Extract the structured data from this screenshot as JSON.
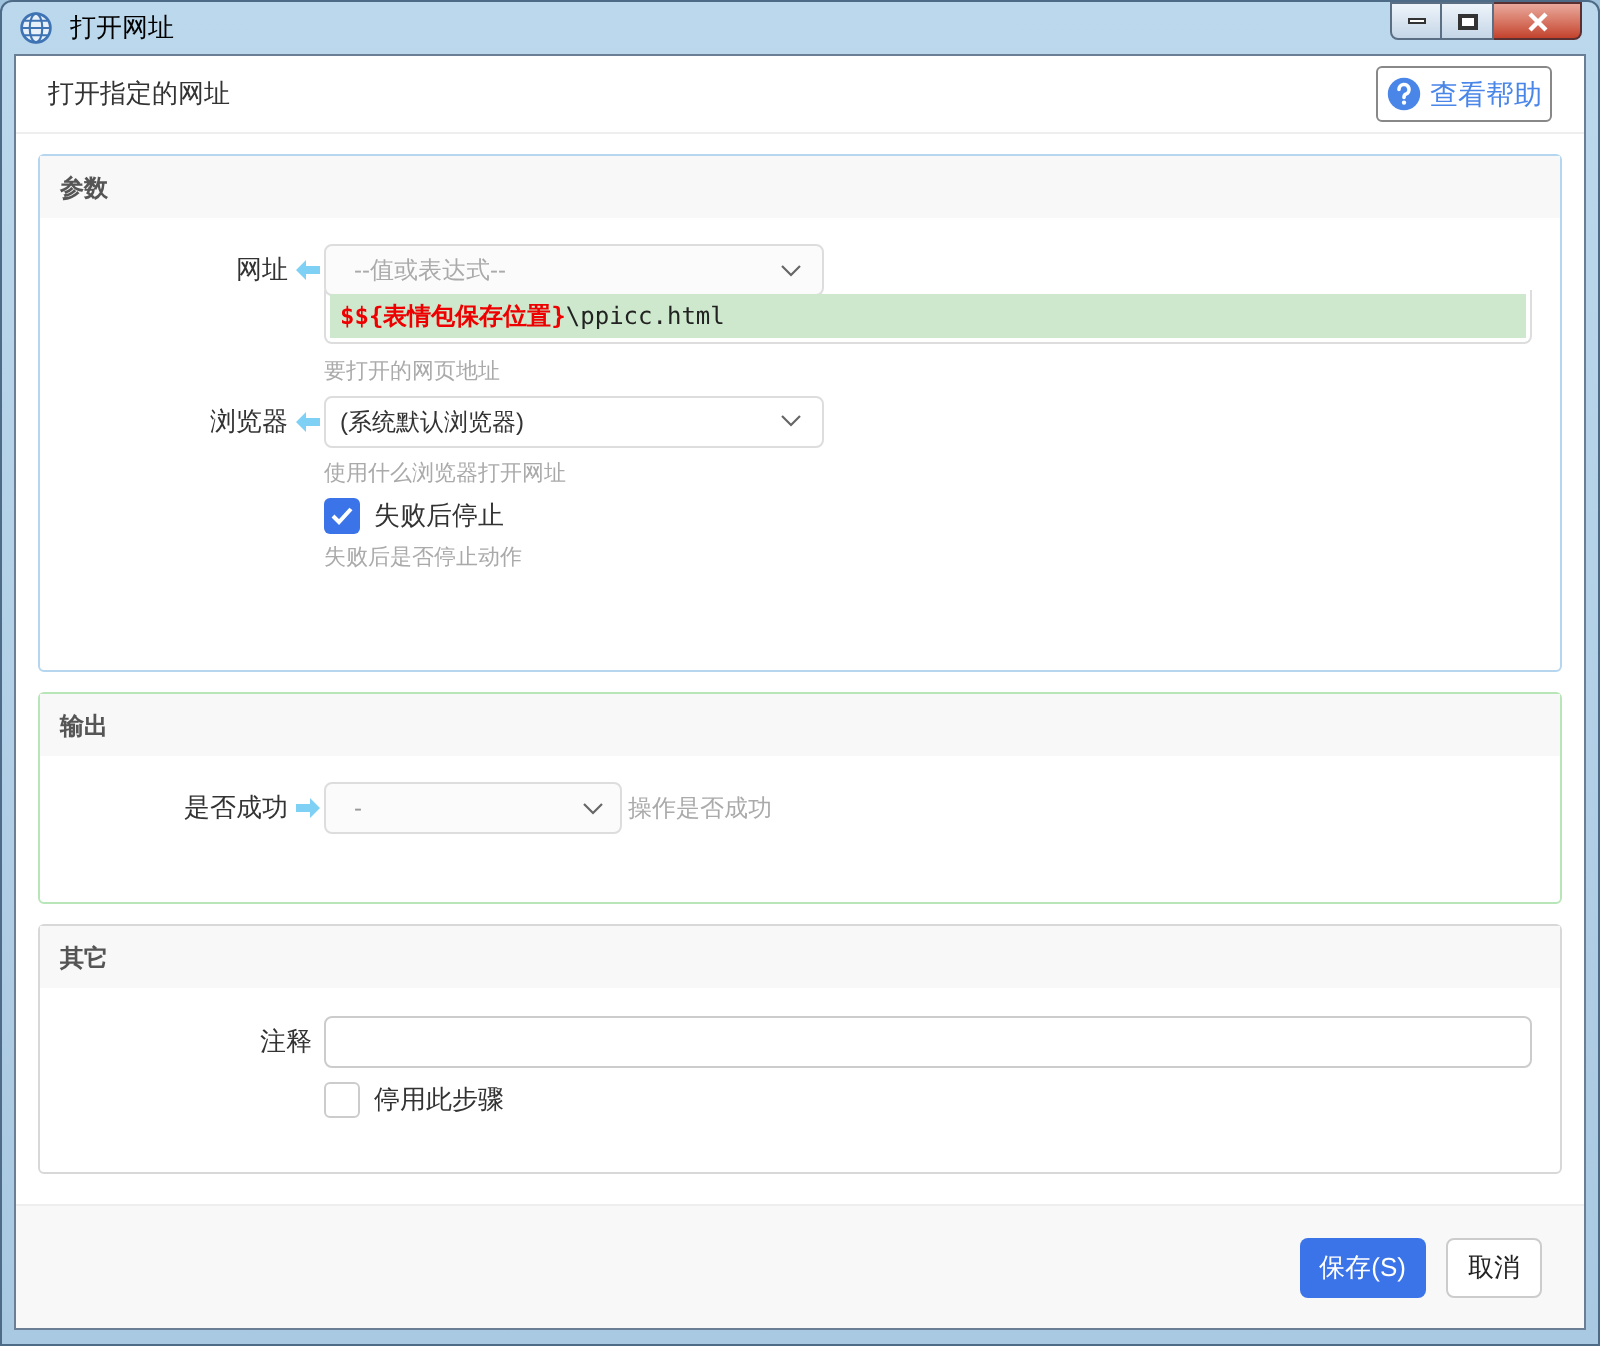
{
  "window": {
    "title": "打开网址"
  },
  "subtitle": "打开指定的网址",
  "help_button": "查看帮助",
  "sections": [
    {
      "title": "参数",
      "kind": "params",
      "rows": [
        {
          "kind": "select",
          "label": "网址",
          "placeholder": "--值或表达式--",
          "expression": [
            {
              "kind": "variable",
              "text": "$${表情包保存位置}"
            },
            {
              "kind": "literal",
              "text": "\\ppicc.html"
            }
          ],
          "hint": "要打开的网页地址"
        },
        {
          "kind": "select",
          "label": "浏览器",
          "value": "(系统默认浏览器)",
          "hint": "使用什么浏览器打开网址"
        },
        {
          "kind": "checkbox",
          "label": "失败后停止",
          "checked": true,
          "hint": "失败后是否停止动作"
        }
      ]
    },
    {
      "title": "输出",
      "kind": "output",
      "rows": [
        {
          "kind": "output",
          "label": "是否成功",
          "value": "-",
          "note": "操作是否成功"
        }
      ]
    },
    {
      "title": "其它",
      "kind": "other",
      "rows": [
        {
          "kind": "text",
          "label": "注释"
        },
        {
          "kind": "checkbox",
          "label": "停用此步骤",
          "checked": false
        }
      ]
    }
  ],
  "buttons": [
    {
      "label": "保存(S)",
      "kind": "primary"
    },
    {
      "label": "取消",
      "kind": "secondary"
    }
  ]
}
